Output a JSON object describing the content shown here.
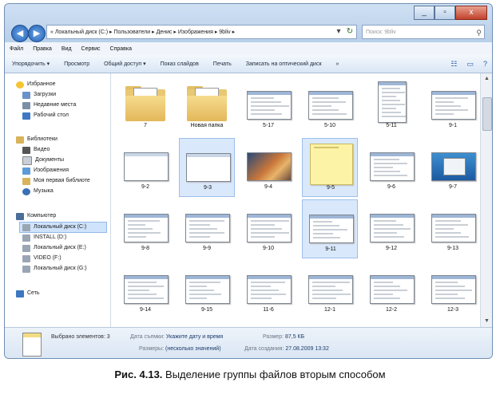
{
  "window": {
    "controls": [
      "_",
      "▫",
      "x"
    ]
  },
  "navigation": {
    "back_glyph": "◀",
    "forward_glyph": "▶",
    "address": "« Локальный диск (C:) ▸ Пользователи ▸ Денис ▸ Изображения ▸ 9bliv ▸",
    "address_dropdown": "▾",
    "refresh_glyph": "↻",
    "search_placeholder": "Поиск: 9bliv"
  },
  "menu": [
    "Файл",
    "Правка",
    "Вид",
    "Сервис",
    "Справка"
  ],
  "commands": {
    "organize": "Упорядочить ▾",
    "preview": "Просмотр",
    "share": "Общий доступ ▾",
    "slideshow": "Показ слайдов",
    "print": "Печать",
    "burn": "Записать на оптический диск",
    "more": "»",
    "view_glyph": "☷",
    "pane_glyph": "▭",
    "help_glyph": "?"
  },
  "sidebar": {
    "favorites": {
      "title": "Избранное",
      "items": [
        "Загрузки",
        "Недавние места",
        "Рабочий стол"
      ]
    },
    "libraries": {
      "title": "Библиотеки",
      "items": [
        "Видео",
        "Документы",
        "Изображения",
        "Моя первая библиоте",
        "Музыка"
      ]
    },
    "computer": {
      "title": "Компьютер",
      "items": [
        "Локальный диск (C:)",
        "INSTALL (D:)",
        "Локальный диск (E:)",
        "VIDEO (F:)",
        "Локальный диск (G:)"
      ]
    },
    "network": "Сеть"
  },
  "files": [
    {
      "label": "7",
      "kind": "folder",
      "selected": false
    },
    {
      "label": "Новая папка",
      "kind": "folder",
      "selected": false
    },
    {
      "label": "5-17",
      "kind": "shot",
      "selected": false
    },
    {
      "label": "5-10",
      "kind": "shot",
      "selected": false
    },
    {
      "label": "5-11",
      "kind": "tall",
      "selected": false
    },
    {
      "label": "9-1",
      "kind": "shot",
      "selected": false
    },
    {
      "label": "9-2",
      "kind": "blank",
      "selected": false
    },
    {
      "label": "9-3",
      "kind": "blank",
      "selected": true
    },
    {
      "label": "9-4",
      "kind": "photo",
      "selected": false
    },
    {
      "label": "9-5",
      "kind": "note",
      "selected": true
    },
    {
      "label": "9-6",
      "kind": "shot",
      "selected": false
    },
    {
      "label": "9-7",
      "kind": "desktop",
      "selected": false
    },
    {
      "label": "9-8",
      "kind": "shot",
      "selected": false
    },
    {
      "label": "9-9",
      "kind": "shot",
      "selected": false
    },
    {
      "label": "9-10",
      "kind": "shot",
      "selected": false
    },
    {
      "label": "9-11",
      "kind": "shot",
      "selected": true
    },
    {
      "label": "9-12",
      "kind": "shot",
      "selected": false
    },
    {
      "label": "9-13",
      "kind": "shot",
      "selected": false
    },
    {
      "label": "9-14",
      "kind": "shot",
      "selected": false
    },
    {
      "label": "9-15",
      "kind": "shot",
      "selected": false
    },
    {
      "label": "11-6",
      "kind": "shot",
      "selected": false
    },
    {
      "label": "12-1",
      "kind": "shot",
      "selected": false
    },
    {
      "label": "12-2",
      "kind": "shot",
      "selected": false
    },
    {
      "label": "12-3",
      "kind": "shot",
      "selected": false
    }
  ],
  "scrollbar": {
    "up": "▲",
    "down": "▼"
  },
  "status": {
    "selected": "Выбрано элементов: 3",
    "date_taken_label": "Дата съемки:",
    "date_taken_value": "Укажите дату и время",
    "size_label": "Размер:",
    "size_value": "87,5 КБ",
    "dimensions_label": "Размеры:",
    "dimensions_value": "(несколько значений)",
    "created_label": "Дата создания:",
    "created_value": "27.08.2009 13:32"
  },
  "caption": {
    "prefix": "Рис. 4.13.",
    "text": " Выделение группы файлов вторым способом"
  },
  "colors": {
    "accent": "#2460b0",
    "selection": "#d9e8fb",
    "folder": "#e9c873"
  }
}
